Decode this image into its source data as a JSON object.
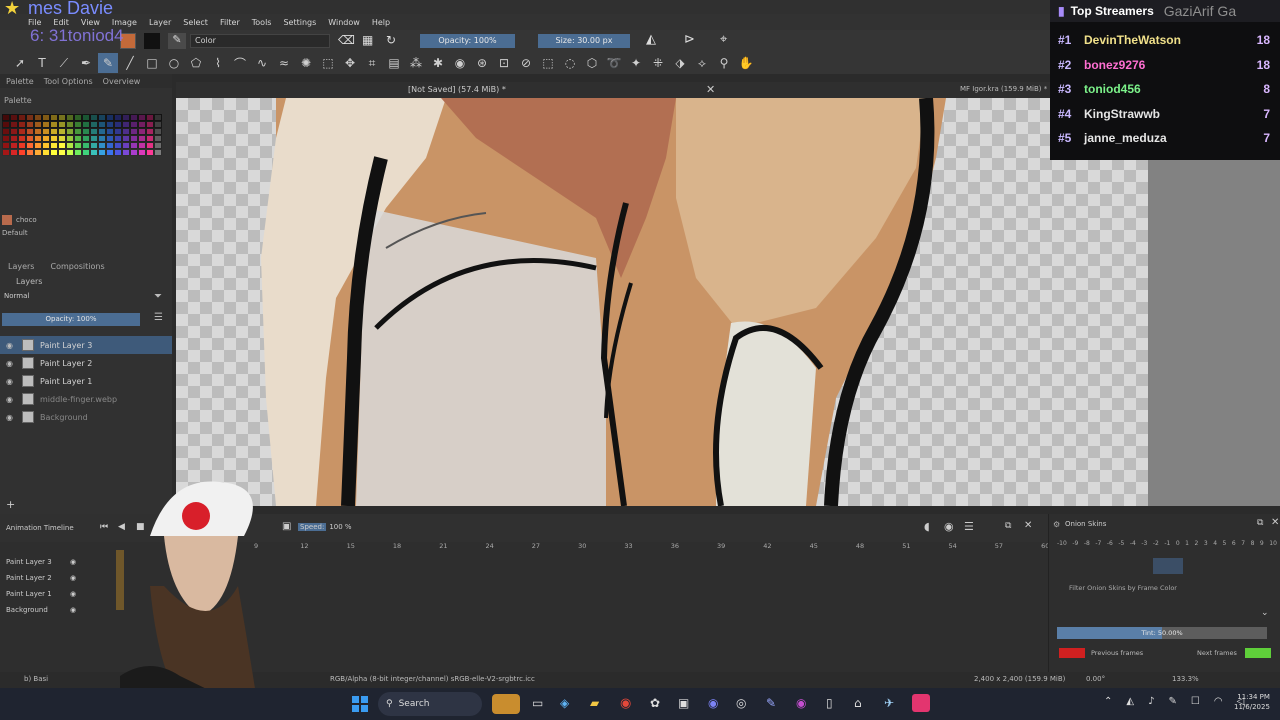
{
  "overlay": {
    "name_text": "mes Davie",
    "counter_text": "6: 31toniod4",
    "top_right_text": "Top Streamers",
    "top_right_faded": "GaziArif Ga"
  },
  "menu": [
    "File",
    "Edit",
    "View",
    "Image",
    "Layer",
    "Select",
    "Filter",
    "Tools",
    "Settings",
    "Window",
    "Help"
  ],
  "tool_options": {
    "blend_label": "Color",
    "opacity_label": "Opacity: 100%",
    "size_label": "Size: 30.00 px"
  },
  "left_dock": {
    "tabs": [
      "Palette",
      "Tool Options",
      "Overview"
    ],
    "palette_title": "Palette",
    "swatch_name": "choco",
    "preset_label": "Default",
    "layers_tabs": [
      "Layers",
      "Compositions"
    ],
    "layers_title": "Layers",
    "blend_mode": "Normal",
    "opacity": "Opacity: 100%",
    "layers": [
      {
        "name": "Paint Layer 3",
        "selected": true
      },
      {
        "name": "Paint Layer 2",
        "selected": false
      },
      {
        "name": "Paint Layer 1",
        "selected": false
      },
      {
        "name": "middle-finger.webp",
        "selected": false
      },
      {
        "name": "Background",
        "selected": false
      }
    ]
  },
  "canvas": {
    "tab_title": "[Not Saved]  (57.4 MiB) *",
    "tab_right": "MF Igor.kra  (159.9 MiB) *"
  },
  "timeline": {
    "title": "Animation Timeline",
    "speed_label": "Speed:",
    "speed_value": "100 %",
    "frames": [
      "9",
      "12",
      "15",
      "18",
      "21",
      "24",
      "27",
      "30",
      "33",
      "36",
      "39",
      "42",
      "45",
      "48",
      "51",
      "54",
      "57",
      "60"
    ],
    "layers": [
      "Paint Layer 3",
      "Paint Layer 2",
      "Paint Layer 1",
      "Background"
    ]
  },
  "onion": {
    "title": "Onion Skins",
    "numbers": [
      "-10",
      "-9",
      "-8",
      "-7",
      "-6",
      "-5",
      "-4",
      "-3",
      "-2",
      "-1",
      "0",
      "1",
      "2",
      "3",
      "4",
      "5",
      "6",
      "7",
      "8",
      "9",
      "10"
    ],
    "filter_label": "Filter Onion Skins by Frame Color",
    "tint_label": "Tint: 50.00%",
    "tint_fraction": 0.5,
    "prev_label": "Previous frames",
    "next_label": "Next frames",
    "prev_color": "#d02020",
    "next_color": "#5fcf3a"
  },
  "status": {
    "left": "b) Basi",
    "color_profile": "RGB/Alpha (8-bit integer/channel)  sRGB-elle-V2-srgbtrc.icc",
    "image_size": "2,400 x 2,400 (159.9 MiB)",
    "rotation": "0.00°",
    "zoom": "133.3%"
  },
  "taskbar": {
    "search_placeholder": "Search",
    "time": "11:34 PM",
    "date": "11/6/2025"
  },
  "streamers": {
    "title": "Top Streamers",
    "rows": [
      {
        "rank": "#1",
        "name": "DevinTheWatson",
        "value": "18",
        "color": "#f0e08a"
      },
      {
        "rank": "#2",
        "name": "bonez9276",
        "value": "18",
        "color": "#ff6fd2"
      },
      {
        "rank": "#3",
        "name": "toniod456",
        "value": "8",
        "color": "#7cf28a"
      },
      {
        "rank": "#4",
        "name": "KingStrawwb",
        "value": "7",
        "color": "#e6e6e6"
      },
      {
        "rank": "#5",
        "name": "janne_meduza",
        "value": "7",
        "color": "#e6e6e6"
      }
    ]
  }
}
